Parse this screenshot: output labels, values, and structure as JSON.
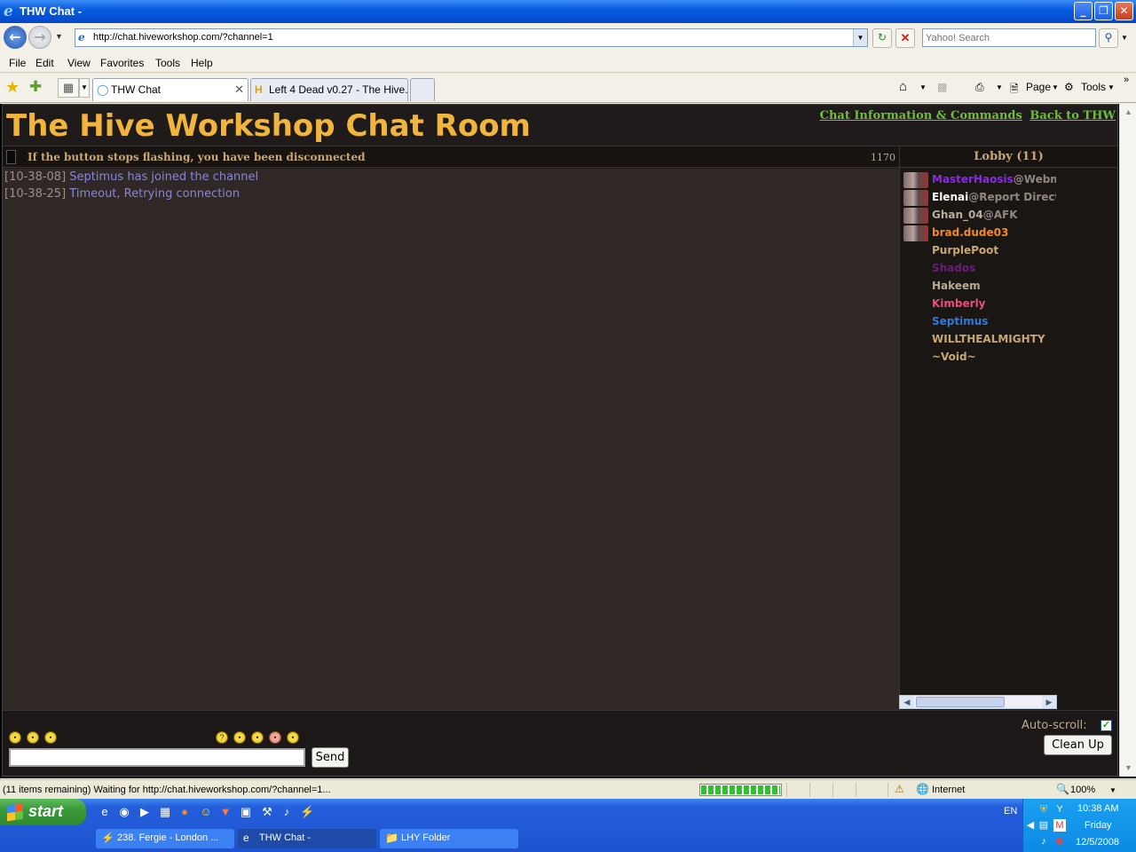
{
  "window": {
    "title": "THW Chat -",
    "minimize_glyph": "_",
    "maximize_glyph": "❐",
    "close_glyph": "✕"
  },
  "browser": {
    "url": "http://chat.hiveworkshop.com/?channel=1",
    "search_placeholder": "Yahoo! Search",
    "menus": [
      "File",
      "Edit",
      "View",
      "Favorites",
      "Tools",
      "Help"
    ],
    "tabs": [
      {
        "label": "THW Chat"
      },
      {
        "label": "Left 4 Dead v0.27 - The Hive..."
      }
    ],
    "commands": {
      "page": "Page",
      "tools": "Tools"
    },
    "status_text": "(11 items remaining) Waiting for http://chat.hiveworkshop.com/?channel=1...",
    "progress": 1.0,
    "zone": "Internet",
    "zoom": "100%"
  },
  "chat": {
    "title": "The Hive Workshop Chat Room",
    "links": {
      "info": "Chat Information & Commands",
      "back": "Back to THW"
    },
    "status": "If the button stops flashing, you have been disconnected",
    "counter": "1170",
    "lobby": "Lobby (11)",
    "messages": [
      {
        "time": "[10-38-08]",
        "text": "Septimus has joined the channel"
      },
      {
        "time": "[10-38-25]",
        "text": "Timeout, Retrying connection"
      }
    ],
    "users": [
      {
        "name": "MasterHaosis",
        "role": "@Webma",
        "color": "#8a2be2",
        "avatar": true
      },
      {
        "name": "Elenai",
        "role": "@Report Directo",
        "color": "#ffffff",
        "avatar": true
      },
      {
        "name": "Ghan_04",
        "role": "@AFK",
        "color": "#b9ab98",
        "avatar": true
      },
      {
        "name": "brad.dude03",
        "role": "",
        "color": "#f08a24",
        "avatar": true
      },
      {
        "name": "PurplePoot",
        "role": "",
        "color": "#c9a772",
        "avatar": false
      },
      {
        "name": "Shados",
        "role": "",
        "color": "#6a1c7a",
        "avatar": false
      },
      {
        "name": "Hakeem",
        "role": "",
        "color": "#b9ab98",
        "avatar": false
      },
      {
        "name": "Kimberly",
        "role": "",
        "color": "#f04a7a",
        "avatar": false
      },
      {
        "name": "Septimus",
        "role": "",
        "color": "#2f7ad8",
        "avatar": false
      },
      {
        "name": "WILLTHEALMIGHTY",
        "role": "",
        "color": "#c9a772",
        "avatar": false
      },
      {
        "name": "~Void~",
        "role": "",
        "color": "#c9a772",
        "avatar": false
      }
    ],
    "input_value": "",
    "send_label": "Send",
    "autoscroll_label": "Auto-scroll:",
    "autoscroll_checked": true,
    "cleanup_label": "Clean Up"
  },
  "taskbar": {
    "start_label": "start",
    "tasks": [
      {
        "label": "238. Fergie - London ..."
      },
      {
        "label": "THW Chat -"
      },
      {
        "label": "LHY Folder"
      }
    ],
    "lang": "EN",
    "time": "10:38 AM",
    "day": "Friday",
    "date": "12/5/2008"
  }
}
